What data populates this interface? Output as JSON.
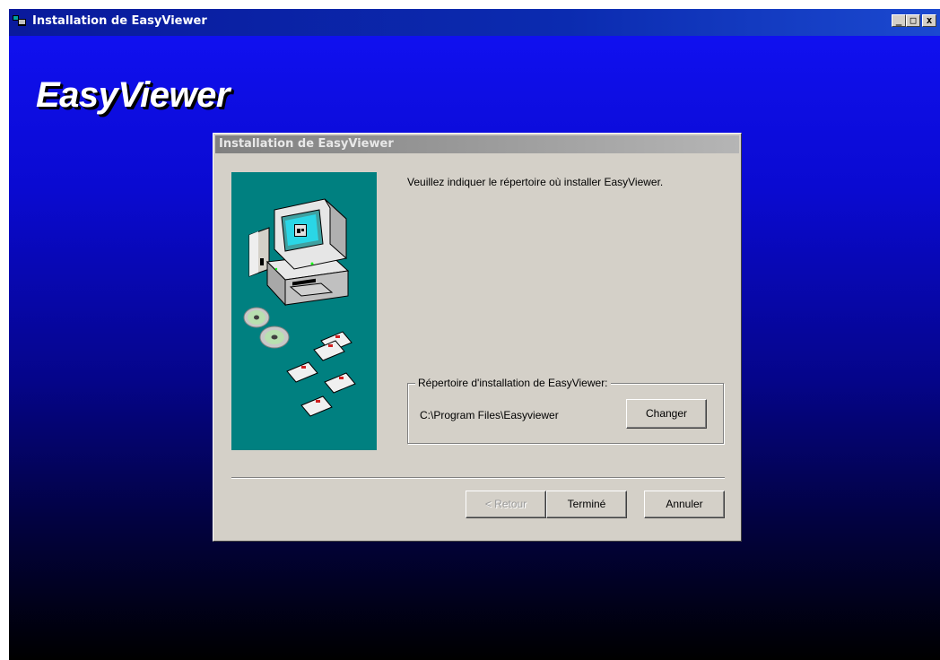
{
  "window": {
    "title": "Installation de EasyViewer",
    "buttons": {
      "minimize": "_",
      "maximize": "□",
      "close": "x"
    }
  },
  "brand": {
    "name": "EasyViewer"
  },
  "dialog": {
    "title": "Installation de EasyViewer",
    "prompt": "Veuillez indiquer le répertoire où installer EasyViewer.",
    "group": {
      "label": "Répertoire d'installation de EasyViewer:",
      "path": "C:\\Program Files\\Easyviewer",
      "change_button": "Changer"
    },
    "buttons": {
      "back": "< Retour",
      "finish": "Terminé",
      "cancel": "Annuler"
    }
  },
  "colors": {
    "titlebar": "#0a1a9c",
    "background_top": "#1010f0",
    "background_bottom": "#000000",
    "dialog": "#d4d0c8",
    "art_panel": "#008080"
  },
  "icons": [
    "app-icon",
    "computer-icon",
    "cd-icon",
    "floppy-icon"
  ]
}
